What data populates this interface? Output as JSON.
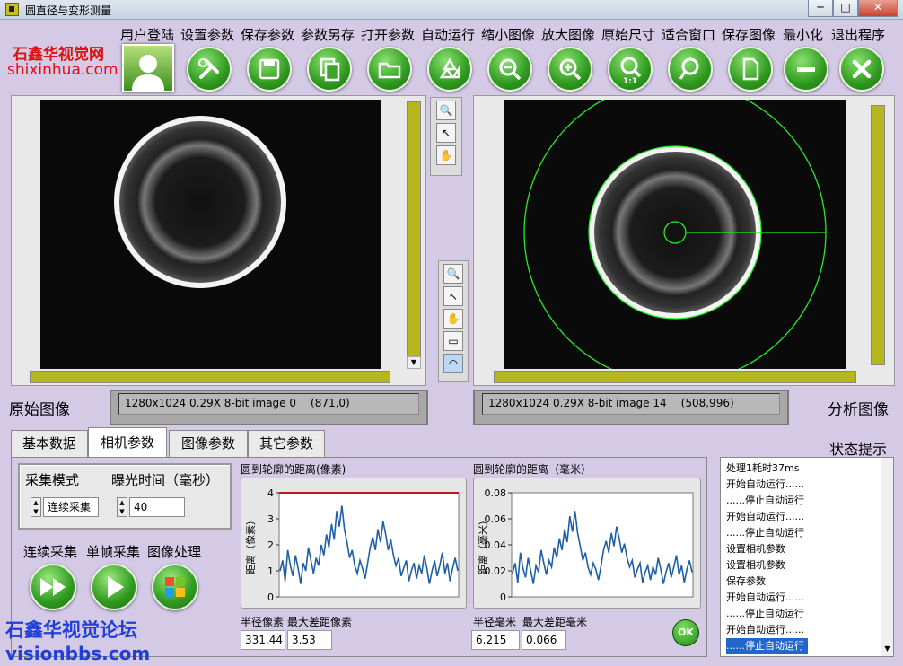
{
  "window": {
    "title": "圆直径与变形测量",
    "min": "─",
    "max": "□",
    "close": "✕"
  },
  "toolbar": {
    "labels": [
      "用户登陆",
      "设置参数",
      "保存参数",
      "参数另存",
      "打开参数",
      "自动运行",
      "缩小图像",
      "放大图像",
      "原始尺寸",
      "适合窗口",
      "保存图像",
      "最小化",
      "退出程序"
    ],
    "icons": [
      "user-icon",
      "tools-icon",
      "save-icon",
      "copy-icon",
      "folder-icon",
      "recycle-icon",
      "zoom-out-icon",
      "zoom-in-icon",
      "zoom-actual-icon",
      "zoom-fit-icon",
      "document-icon",
      "minus-icon",
      "close-icon"
    ],
    "actual_size_caption": "1:1"
  },
  "watermark_top": {
    "line1": "石鑫华视觉网",
    "line2": "shixinhua.com"
  },
  "watermark_bottom": {
    "line1": "石鑫华视觉论坛",
    "line2": "visionbbs.com"
  },
  "left_view": {
    "label": "原始图像",
    "info": "1280x1024 0.29X 8-bit image 0",
    "coords": "(871,0)"
  },
  "right_view": {
    "label": "分析图像",
    "info": "1280x1024 0.29X 8-bit image 14",
    "coords": "(508,996)"
  },
  "tabs": [
    "基本数据",
    "相机参数",
    "图像参数",
    "其它参数"
  ],
  "active_tab": 1,
  "camera": {
    "mode_label": "采集模式",
    "mode_value": "连续采集",
    "exposure_label": "曝光时间（毫秒）",
    "exposure_value": "40",
    "buttons": [
      "连续采集",
      "单帧采集",
      "图像处理"
    ]
  },
  "status_title": "状态提示",
  "status_items": [
    "处理1耗时37ms",
    "开始自动运行......",
    "......停止自动运行",
    "开始自动运行......",
    "......停止自动运行",
    "设置相机参数",
    "设置相机参数",
    "保存参数",
    "开始自动运行......",
    "......停止自动运行",
    "开始自动运行......",
    "......停止自动运行"
  ],
  "ok_label": "OK",
  "readouts": {
    "radius_px_label": "半径像素",
    "max_diff_px_label": "最大差距像素",
    "radius_px": "331.44",
    "max_diff_px": "3.53",
    "radius_mm_label": "半径毫米",
    "max_diff_mm_label": "最大差距毫米",
    "radius_mm": "6.215",
    "max_diff_mm": "0.066"
  },
  "colors": {
    "accent_green": "#2f9a1f",
    "plot_line": "#1f5fa8",
    "threshold": "#c01818",
    "scroll": "#b6b61d",
    "overlay": "#22ee22"
  },
  "chart_data": [
    {
      "type": "line",
      "title": "圆到轮廓的距离(像素)",
      "ylabel": "距离（像素）",
      "ylim": [
        0,
        4
      ],
      "yticks": [
        "0",
        "1",
        "2",
        "3",
        "4"
      ],
      "threshold": 4,
      "series": [
        {
          "values": [
            1.0,
            1.4,
            0.6,
            1.8,
            1.2,
            0.8,
            1.6,
            1.1,
            0.5,
            1.3,
            1.0,
            1.9,
            1.4,
            0.9,
            1.5,
            1.2,
            2.0,
            1.6,
            2.4,
            1.9,
            2.8,
            2.2,
            3.3,
            2.7,
            3.5,
            2.6,
            2.1,
            1.5,
            1.8,
            1.2,
            0.9,
            1.4,
            1.1,
            0.7,
            1.3,
            1.9,
            2.3,
            1.8,
            2.6,
            2.1,
            2.9,
            2.4,
            1.8,
            2.2,
            1.6,
            1.2,
            1.5,
            0.8,
            1.1,
            1.4,
            0.6,
            1.0,
            1.3,
            0.7,
            1.2,
            0.9,
            1.6,
            1.1,
            0.5,
            1.0,
            1.4,
            0.8,
            1.2,
            1.7,
            0.9,
            1.3,
            0.6,
            1.1,
            1.5,
            1.0
          ]
        }
      ]
    },
    {
      "type": "line",
      "title": "圆到轮廓的距离（毫米）",
      "ylabel": "距离（毫米）",
      "ylim": [
        0,
        0.08
      ],
      "yticks": [
        "0",
        "0.02",
        "0.04",
        "0.06",
        "0.08"
      ],
      "series": [
        {
          "values": [
            0.018,
            0.026,
            0.011,
            0.034,
            0.022,
            0.015,
            0.03,
            0.02,
            0.01,
            0.024,
            0.019,
            0.036,
            0.026,
            0.017,
            0.028,
            0.023,
            0.038,
            0.03,
            0.045,
            0.036,
            0.052,
            0.042,
            0.062,
            0.05,
            0.066,
            0.049,
            0.039,
            0.028,
            0.034,
            0.023,
            0.017,
            0.026,
            0.021,
            0.013,
            0.024,
            0.036,
            0.043,
            0.034,
            0.049,
            0.039,
            0.054,
            0.045,
            0.034,
            0.041,
            0.03,
            0.023,
            0.028,
            0.015,
            0.021,
            0.026,
            0.011,
            0.019,
            0.024,
            0.013,
            0.023,
            0.017,
            0.03,
            0.021,
            0.01,
            0.019,
            0.026,
            0.015,
            0.023,
            0.032,
            0.017,
            0.024,
            0.011,
            0.021,
            0.028,
            0.019
          ]
        }
      ]
    }
  ]
}
